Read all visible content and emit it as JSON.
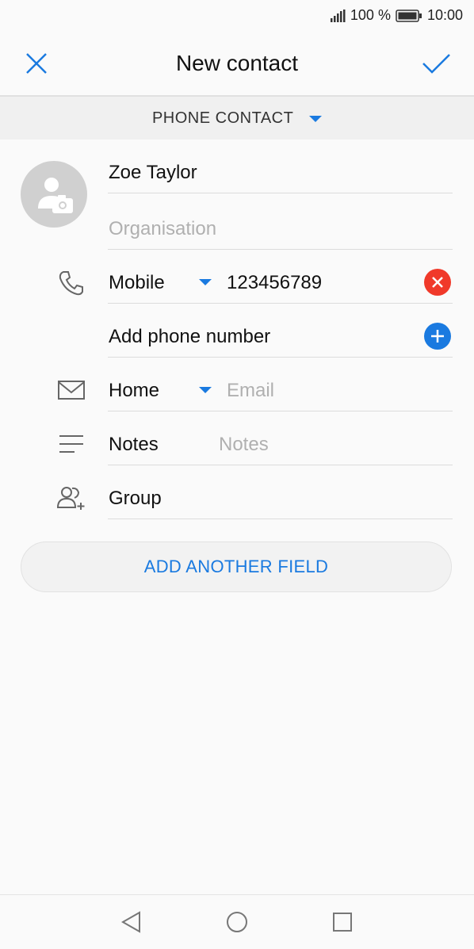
{
  "status": {
    "battery": "100 %",
    "time": "10:00"
  },
  "header": {
    "title": "New contact",
    "cancel_icon": "close-icon",
    "confirm_icon": "check-icon"
  },
  "account": {
    "label": "PHONE CONTACT"
  },
  "name_field": {
    "value": "Zoe Taylor"
  },
  "organisation_field": {
    "placeholder": "Organisation"
  },
  "phone": {
    "type": "Mobile",
    "value": "123456789"
  },
  "add_phone": {
    "label": "Add phone number"
  },
  "email": {
    "type": "Home",
    "placeholder": "Email"
  },
  "notes": {
    "label": "Notes",
    "placeholder": "Notes"
  },
  "group": {
    "label": "Group"
  },
  "add_field_button": {
    "label": "ADD ANOTHER FIELD"
  },
  "colors": {
    "accent": "#1a7ae0",
    "danger": "#f0392a",
    "add": "#1a7ae0"
  }
}
